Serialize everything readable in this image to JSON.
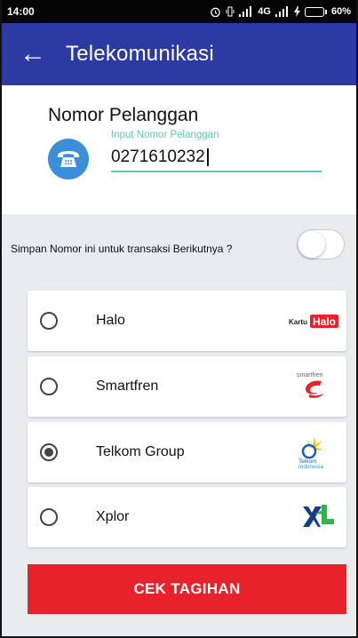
{
  "status_bar": {
    "time": "14:00",
    "network": "4G",
    "battery": "60%",
    "battery_level": 0.6
  },
  "app_bar": {
    "back_icon": "arrow-left-icon",
    "title": "Telekomunikasi"
  },
  "customer": {
    "label": "Nomor Pelanggan",
    "icon": "telephone-icon",
    "input_hint": "Input Nomor Pelanggan",
    "input_value": "0271610232"
  },
  "save": {
    "label": "Simpan Nomor ini untuk transaksi Berikutnya ?",
    "enabled": false
  },
  "operators": [
    {
      "name": "Halo",
      "selected": false,
      "logo_text": "Kartu Halo"
    },
    {
      "name": "Smartfren",
      "selected": false,
      "logo_text": "smartfren"
    },
    {
      "name": "Telkom Group",
      "selected": true,
      "logo_text": "Telkom Indonesia"
    },
    {
      "name": "Xplor",
      "selected": false,
      "logo_text": ""
    }
  ],
  "submit_label": "CEK TAGIHAN",
  "colors": {
    "app_bar": "#2e3aa3",
    "accent": "#5ec8b6",
    "button": "#e8222b",
    "phone_icon": "#3b8fd9"
  }
}
